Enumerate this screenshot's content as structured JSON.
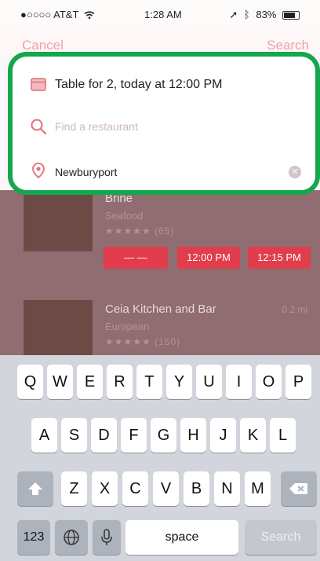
{
  "status_bar": {
    "carrier": "●○○○○ AT&T",
    "wifi_icon": "wifi-icon",
    "time": "1:28 AM",
    "battery_label": "83%",
    "battery_level": 0.83
  },
  "nav": {
    "cancel_label": "Cancel",
    "search_label": "Search"
  },
  "search_panel": {
    "party": {
      "icon": "calendar-icon",
      "text": "Table for 2, today at 12:00 PM"
    },
    "restaurant": {
      "icon": "search-icon",
      "placeholder": "Find a restaurant"
    },
    "location": {
      "icon": "location-pin-icon",
      "value": "Newburyport",
      "clear_icon": "clear-icon"
    }
  },
  "results": [
    {
      "name": "Brine",
      "cuisine": "Seafood",
      "stars": "★★★★★",
      "reviews": "(65)",
      "slots": [
        "— —",
        "12:00 PM",
        "12:15 PM"
      ]
    },
    {
      "name": "Ceia Kitchen and Bar",
      "cuisine": "European",
      "stars": "★★★★★",
      "reviews": "(150)",
      "distance": "0.2 mi"
    }
  ],
  "keyboard": {
    "row1": [
      "Q",
      "W",
      "E",
      "R",
      "T",
      "Y",
      "U",
      "I",
      "O",
      "P"
    ],
    "row2": [
      "A",
      "S",
      "D",
      "F",
      "G",
      "H",
      "J",
      "K",
      "L"
    ],
    "row3": [
      "Z",
      "X",
      "C",
      "V",
      "B",
      "N",
      "M"
    ],
    "shift_icon": "shift-icon",
    "delete_icon": "delete-icon",
    "numbers_label": "123",
    "globe_icon": "globe-icon",
    "mic_icon": "microphone-icon",
    "space_label": "space",
    "search_label": "Search"
  },
  "colors": {
    "accent": "#e23d4c",
    "highlight": "#12a84b"
  }
}
